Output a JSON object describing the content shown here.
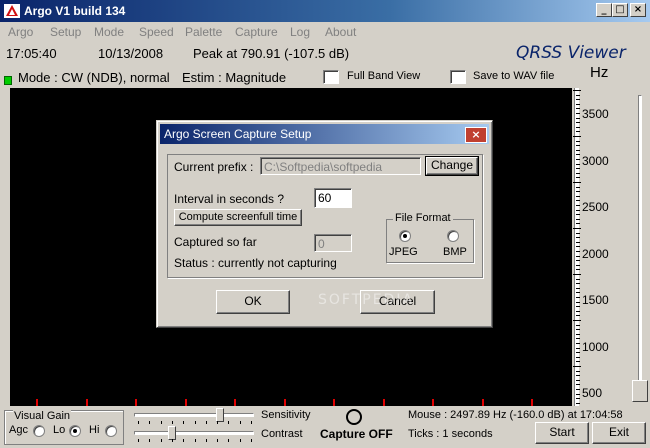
{
  "window": {
    "title": "Argo V1 build 134",
    "minimize": "_",
    "maximize": "□",
    "close": "×"
  },
  "menu": [
    "Argo",
    "Setup",
    "Mode",
    "Speed",
    "Palette",
    "Capture",
    "Log",
    "About"
  ],
  "header": {
    "time": "17:05:40",
    "date": "10/13/2008",
    "peak": "Peak at  790.91  (-107.5 dB)",
    "app_name": "QRSS Viewer",
    "hz": "Hz",
    "mode": "Mode : CW (NDB), normal",
    "estim": "Estim : Magnitude",
    "full_band_view": "Full Band View",
    "save_wav": "Save to WAV file"
  },
  "frequency_scale": {
    "labels": [
      "3500",
      "3000",
      "2500",
      "2000",
      "1500",
      "1000",
      "500"
    ],
    "max_hz": 3500,
    "min_hz": 500
  },
  "dialog": {
    "title": "Argo Screen Capture Setup",
    "close": "×",
    "prefix_label": "Current prefix :",
    "prefix_value": "C:\\Softpedia\\softpedia",
    "change_button": "Change",
    "interval_label": "Interval in seconds ?",
    "interval_value": "60",
    "compute_button": "Compute screenfull time",
    "file_format_label": "File Format",
    "jpeg_label": "JPEG",
    "bmp_label": "BMP",
    "selected_format": "JPEG",
    "captured_label": "Captured so far",
    "captured_value": "0",
    "status": "Status : currently not capturing",
    "ok_button": "OK",
    "cancel_button": "Cancel"
  },
  "watermark": "SOFTPEDIA",
  "bottom": {
    "visual_gain": "Visual Gain",
    "agc": "Agc",
    "lo": "Lo",
    "hi": "Hi",
    "selected_gain": "Lo",
    "sensitivity": "Sensitivity",
    "contrast": "Contrast",
    "capture_status": "Capture OFF",
    "mouse": "Mouse : 2497.89 Hz   (-160.0 dB) at 17:04:58",
    "ticks": "Ticks   : 1 seconds",
    "start_button": "Start",
    "exit_button": "Exit"
  },
  "colors": {
    "title_bar": "#0a246a",
    "waterfall_bg": "#000000",
    "time_marker": "#e00000",
    "status_led": "#00cc00",
    "app_name": "#0a246a"
  }
}
